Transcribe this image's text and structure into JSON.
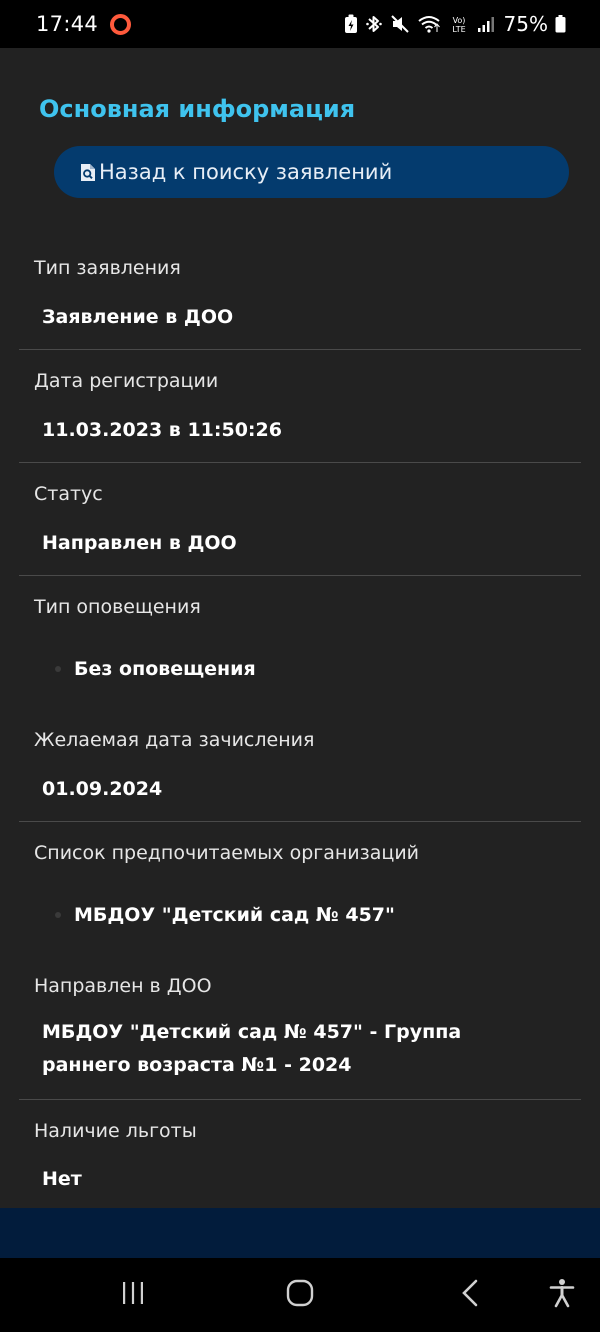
{
  "status_bar": {
    "time": "17:44",
    "battery": "75%"
  },
  "page": {
    "section_title": "Основная информация",
    "back_button_label": "Назад к поиску заявлений"
  },
  "fields": {
    "application_type": {
      "label": "Тип заявления",
      "value": "Заявление в ДОО"
    },
    "registration_date": {
      "label": "Дата регистрации",
      "value": "11.03.2023 в 11:50:26"
    },
    "status": {
      "label": "Статус",
      "value": "Направлен в ДОО"
    },
    "notification_type": {
      "label": "Тип оповещения",
      "items": [
        "Без оповещения"
      ]
    },
    "desired_enrollment_date": {
      "label": "Желаемая дата зачисления",
      "value": "01.09.2024"
    },
    "preferred_organizations": {
      "label": "Список предпочитаемых организаций",
      "items": [
        "МБДОУ \"Детский сад № 457\""
      ]
    },
    "directed_to": {
      "label": "Направлен в ДОО",
      "value": "МБДОУ \"Детский сад № 457\" - Группа раннего возраста №1 - 2024"
    },
    "benefit": {
      "label": "Наличие льготы",
      "value": "Нет"
    }
  },
  "colors": {
    "accent": "#3fc3ee",
    "button_bg": "#043b6e",
    "background": "#222222",
    "footer": "#021c3c"
  },
  "icons": {
    "back_button": "document-search-icon",
    "status_bar": [
      "screen-record-icon",
      "battery-saver-icon",
      "bluetooth-icon",
      "mute-icon",
      "wifi-icon",
      "volte-icon",
      "signal-icon",
      "battery-icon"
    ],
    "nav_bar": [
      "recent-apps-icon",
      "home-icon",
      "back-icon",
      "accessibility-icon"
    ]
  }
}
